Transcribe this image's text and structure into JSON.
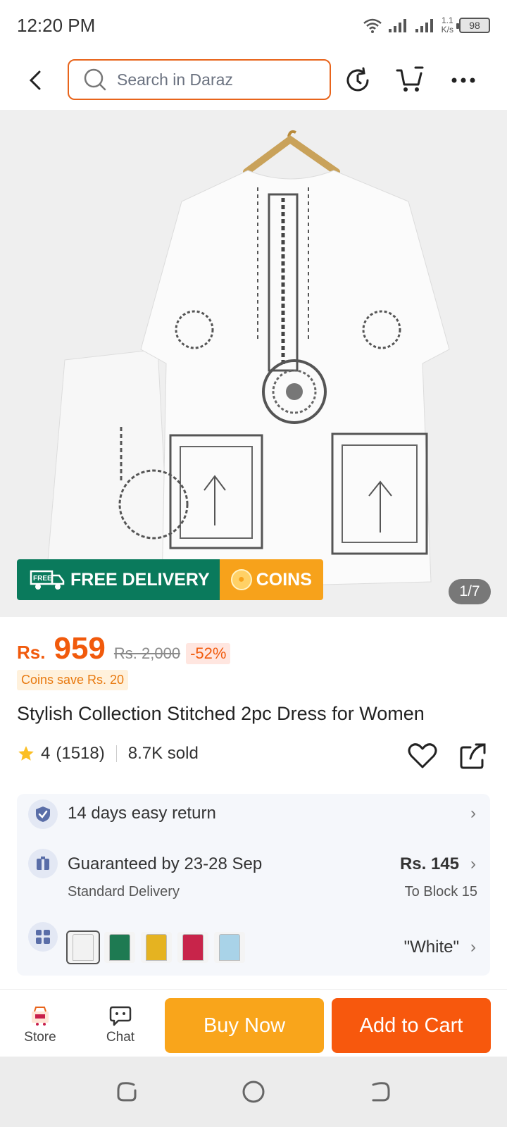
{
  "status_bar": {
    "time": "12:20 PM",
    "speed_value": "1.1",
    "speed_unit": "K/s",
    "battery": "98"
  },
  "search": {
    "placeholder": "Search in Daraz"
  },
  "gallery": {
    "counter": "1/7",
    "promo_free_badge": "FREE",
    "promo_free_text": "FREE DELIVERY",
    "promo_coins_text": "COINS"
  },
  "product": {
    "currency": "Rs.",
    "price": "959",
    "original_price": "Rs. 2,000",
    "discount": "-52%",
    "coins_save": "Coins save Rs. 20",
    "title": "Stylish Collection Stitched 2pc Dress for Women",
    "rating": "4",
    "rating_count": "(1518)",
    "sold": "8.7K sold"
  },
  "info": {
    "return_policy": "14 days easy return",
    "delivery_guarantee": "Guaranteed by 23-28 Sep",
    "delivery_type": "Standard Delivery",
    "shipping_price": "Rs. 145",
    "shipping_dest": "To Block 15",
    "selected_variant": "\"White\"",
    "swatch_colors": [
      "#f2f2f2",
      "#1e7a52",
      "#e5b321",
      "#c8244a",
      "#a9d3e8"
    ]
  },
  "bottom_bar": {
    "store_label": "Store",
    "chat_label": "Chat",
    "buy_now_label": "Buy Now",
    "add_to_cart_label": "Add to Cart"
  },
  "colors": {
    "accent_orange": "#f15a0c",
    "buy_now": "#f9a51b",
    "add_to_cart": "#f7580d",
    "free_delivery": "#0a7a5c",
    "coins": "#f7a21b"
  }
}
